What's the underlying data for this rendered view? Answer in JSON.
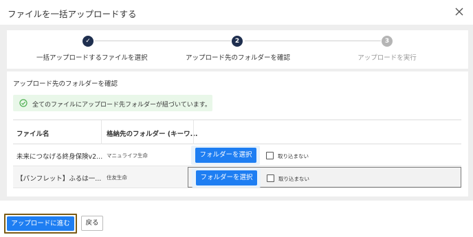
{
  "dialog": {
    "title": "ファイルを一括アップロードする"
  },
  "stepper": {
    "steps": [
      {
        "number": "✓",
        "label": "一括アップロードするファイルを選択",
        "state": "done"
      },
      {
        "number": "2",
        "label": "アップロード先のフォルダーを確認",
        "state": "active"
      },
      {
        "number": "3",
        "label": "アップロードを実行",
        "state": "todo"
      }
    ]
  },
  "section": {
    "title": "アップロード先のフォルダーを確認",
    "alert": "全てのファイルにアップロード先フォルダーが紐づいています。"
  },
  "table": {
    "headers": [
      "ファイル名",
      "格納先のフォルダー (キーワ..."
    ],
    "rows": [
      {
        "file": "未来につなげる終身保険v2...",
        "folder": "マニュライフ生命",
        "select_label": "フォルダーを選択",
        "skip_label": "取り込まない"
      },
      {
        "file": "【パンフレット】ふるは一...",
        "folder": "住友生命",
        "select_label": "フォルダーを選択",
        "skip_label": "取り込まない"
      }
    ]
  },
  "footer": {
    "next_label": "アップロードに進む",
    "back_label": "戻る"
  },
  "colors": {
    "primary": "#1e7ef2",
    "step_active": "#1f2f4f",
    "step_todo": "#b5b5b5",
    "alert_bg": "#e9f7e9",
    "alert_icon": "#4caf50"
  }
}
